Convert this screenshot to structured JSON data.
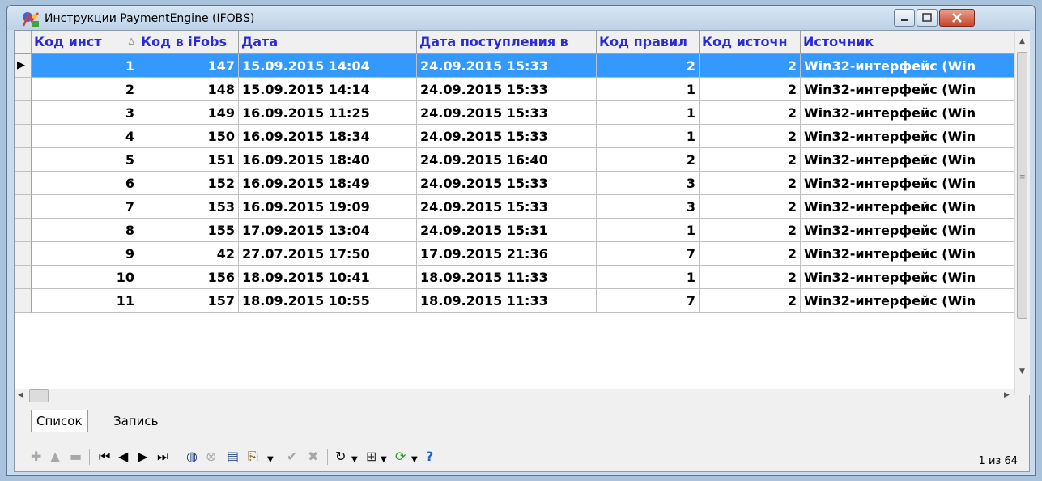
{
  "window": {
    "title": "Инструкции PaymentEngine (IFOBS)"
  },
  "grid": {
    "columns": [
      "Код инст",
      "Код в iFobs",
      "Дата",
      "Дата поступления в",
      "Код правил",
      "Код источн",
      "Источник"
    ],
    "sort_indicator": "∆",
    "rows": [
      [
        "1",
        "147",
        "15.09.2015 14:04",
        "24.09.2015 15:33",
        "2",
        "2",
        "Win32-интерфейс (Win"
      ],
      [
        "2",
        "148",
        "15.09.2015 14:14",
        "24.09.2015 15:33",
        "1",
        "2",
        "Win32-интерфейс (Win"
      ],
      [
        "3",
        "149",
        "16.09.2015 11:25",
        "24.09.2015 15:33",
        "1",
        "2",
        "Win32-интерфейс (Win"
      ],
      [
        "4",
        "150",
        "16.09.2015 18:34",
        "24.09.2015 15:33",
        "1",
        "2",
        "Win32-интерфейс (Win"
      ],
      [
        "5",
        "151",
        "16.09.2015 18:40",
        "24.09.2015 16:40",
        "2",
        "2",
        "Win32-интерфейс (Win"
      ],
      [
        "6",
        "152",
        "16.09.2015 18:49",
        "24.09.2015 15:33",
        "3",
        "2",
        "Win32-интерфейс (Win"
      ],
      [
        "7",
        "153",
        "16.09.2015 19:09",
        "24.09.2015 15:33",
        "3",
        "2",
        "Win32-интерфейс (Win"
      ],
      [
        "8",
        "155",
        "17.09.2015 13:04",
        "24.09.2015 15:31",
        "1",
        "2",
        "Win32-интерфейс (Win"
      ],
      [
        "9",
        "42",
        "27.07.2015 17:50",
        "17.09.2015 21:36",
        "7",
        "2",
        "Win32-интерфейс (Win"
      ],
      [
        "10",
        "156",
        "18.09.2015 10:41",
        "18.09.2015 11:33",
        "1",
        "2",
        "Win32-интерфейс (Win"
      ],
      [
        "11",
        "157",
        "18.09.2015 10:55",
        "18.09.2015 11:33",
        "7",
        "2",
        "Win32-интерфейс (Win"
      ]
    ],
    "selected_row_index": 0
  },
  "tabs": [
    {
      "label": "Список"
    },
    {
      "label": "Запись"
    }
  ],
  "toolbar": {
    "buttons": [
      {
        "name": "add",
        "icon": "plus-icon",
        "glyph": "✚",
        "disabled": true
      },
      {
        "name": "up",
        "icon": "triangle-up-icon",
        "glyph": "▲",
        "disabled": true
      },
      {
        "name": "delete",
        "icon": "minus-icon",
        "glyph": "▬",
        "disabled": true
      },
      {
        "name": "first",
        "icon": "first-record-icon",
        "glyph": "⏮",
        "disabled": false
      },
      {
        "name": "prior",
        "icon": "prior-record-icon",
        "glyph": "◀",
        "disabled": false
      },
      {
        "name": "next",
        "icon": "next-record-icon",
        "glyph": "▶",
        "disabled": false
      },
      {
        "name": "last",
        "icon": "last-record-icon",
        "glyph": "⏭",
        "disabled": false
      },
      {
        "name": "filter",
        "icon": "globe-icon",
        "glyph": "◍",
        "disabled": false
      },
      {
        "name": "filter-off",
        "icon": "globe-off-icon",
        "glyph": "⊗",
        "disabled": true
      },
      {
        "name": "form",
        "icon": "form-icon",
        "glyph": "▤",
        "disabled": false
      },
      {
        "name": "copy",
        "icon": "copy-icon",
        "glyph": "⎘",
        "disabled": false
      },
      {
        "name": "post",
        "icon": "check-icon",
        "glyph": "✔",
        "disabled": true
      },
      {
        "name": "cancel",
        "icon": "cancel-icon",
        "glyph": "✖",
        "disabled": true
      },
      {
        "name": "refresh",
        "icon": "redo-icon",
        "glyph": "↻",
        "disabled": false
      },
      {
        "name": "tree",
        "icon": "tree-icon",
        "glyph": "⊞",
        "disabled": false
      },
      {
        "name": "reload",
        "icon": "reload-green-icon",
        "glyph": "⟳",
        "disabled": false
      },
      {
        "name": "help",
        "icon": "help-icon",
        "glyph": "?",
        "disabled": false
      }
    ],
    "record_status": "1 из 64"
  },
  "colors": {
    "header_text": "#2b2bd6",
    "selection": "#3399ff",
    "titlebar": "#c9dbee"
  }
}
